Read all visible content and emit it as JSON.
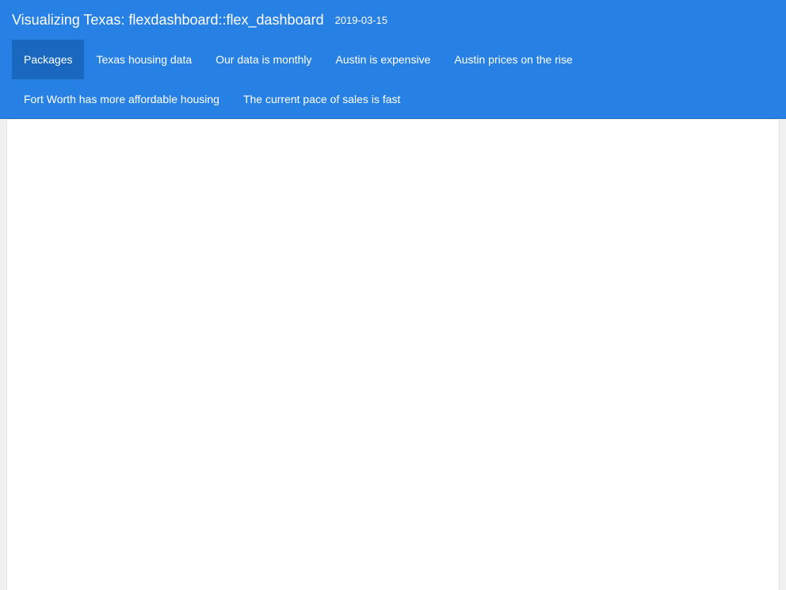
{
  "header": {
    "title": "Visualizing Texas: flexdashboard::flex_dashboard",
    "date": "2019-03-15"
  },
  "nav": {
    "row1": [
      {
        "label": "Packages",
        "active": true
      },
      {
        "label": "Texas housing data"
      },
      {
        "label": "Our data is monthly"
      },
      {
        "label": "Austin is expensive"
      },
      {
        "label": "Austin prices on the rise"
      }
    ],
    "row2": [
      {
        "label": "Fort Worth has more affordable housing"
      },
      {
        "label": "The current pace of sales is fast"
      }
    ]
  },
  "colors": {
    "navbar": "#2780e3",
    "active_tab": "#1967be",
    "background": "#f0f0f0",
    "panel": "#ffffff"
  }
}
